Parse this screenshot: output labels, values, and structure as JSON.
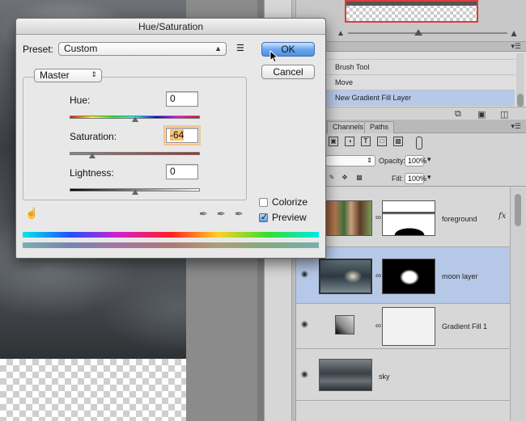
{
  "dialog": {
    "title": "Hue/Saturation",
    "preset_label": "Preset:",
    "preset_value": "Custom",
    "preset_options_glyph": "☰",
    "ok_label": "OK",
    "cancel_label": "Cancel",
    "channel_value": "Master",
    "hue_label": "Hue:",
    "hue_value": "0",
    "saturation_label": "Saturation:",
    "saturation_value": "-64",
    "lightness_label": "Lightness:",
    "lightness_value": "0",
    "colorize_label": "Colorize",
    "colorize_checked": false,
    "preview_label": "Preview",
    "preview_checked": true,
    "icons": [
      "hand-adjust-icon",
      "eyedropper-icon",
      "eyedropper-plus-icon",
      "eyedropper-minus-icon",
      "preset-options-icon"
    ]
  },
  "history": {
    "items": [
      {
        "label": "Brush Tool",
        "active": false
      },
      {
        "label": "Move",
        "active": false
      },
      {
        "label": "New Gradient Fill Layer",
        "active": true
      }
    ],
    "icons": [
      "new-snapshot-icon",
      "camera-icon",
      "trash-icon"
    ]
  },
  "layers_panel": {
    "tabs": [
      "Channels",
      "Paths"
    ],
    "opacity_label": "Opacity:",
    "opacity_value": "100%",
    "fill_label": "Fill:",
    "fill_value": "100%",
    "fx_label": "fx",
    "layers": [
      {
        "name": "foreground",
        "selected": false,
        "visible": false
      },
      {
        "name": "moon layer",
        "selected": true,
        "visible": true
      },
      {
        "name": "Gradient Fill 1",
        "selected": false,
        "visible": true
      },
      {
        "name": "sky",
        "selected": false,
        "visible": true
      }
    ]
  },
  "colors": {
    "accent_blue": "#5d9ae6",
    "selection": "#b6c8e7",
    "nav_frame": "#e03c3c",
    "field_highlight": "#f7c07a"
  }
}
